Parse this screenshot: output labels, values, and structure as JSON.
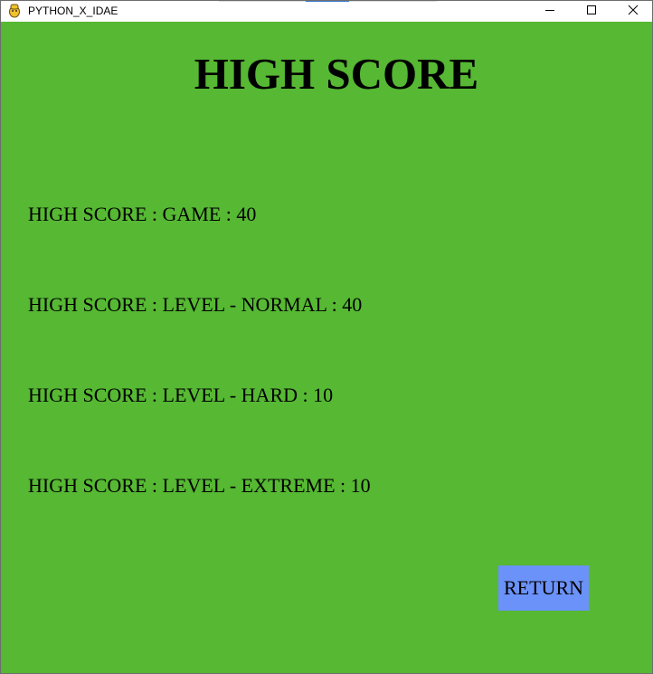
{
  "window": {
    "title": "PYTHON_X_IDAE",
    "app_icon": "python-icon",
    "controls": {
      "minimize_icon": "minimize-icon",
      "maximize_icon": "maximize-icon",
      "close_icon": "close-icon"
    }
  },
  "screen": {
    "background_color": "#56b833",
    "heading": "HIGH SCORE",
    "scores": [
      {
        "label": "HIGH SCORE : GAME : 40",
        "mode": "GAME",
        "value": 40
      },
      {
        "label": "HIGH SCORE : LEVEL - NORMAL : 40",
        "mode": "LEVEL - NORMAL",
        "value": 40
      },
      {
        "label": "HIGH SCORE : LEVEL - HARD : 10",
        "mode": "LEVEL - HARD",
        "value": 10
      },
      {
        "label": "HIGH SCORE : LEVEL - EXTREME : 10",
        "mode": "LEVEL - EXTREME",
        "value": 10
      }
    ],
    "return_button": {
      "label": "RETURN",
      "color": "#6b92f8"
    }
  }
}
